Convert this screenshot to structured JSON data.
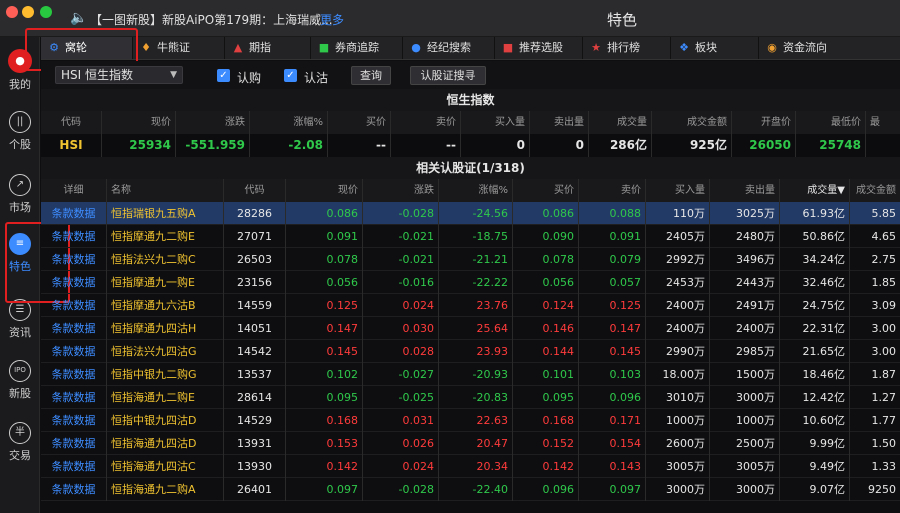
{
  "titlebar": {
    "news_text": "【一图新股】新股AiPO第179期：上海瑞威...",
    "more_label": "更多",
    "window_title": "特色"
  },
  "sidebar": {
    "items": [
      {
        "label": "我的",
        "icon": "avatar-icon"
      },
      {
        "label": "个股",
        "icon": "stock-icon"
      },
      {
        "label": "市场",
        "icon": "market-icon"
      },
      {
        "label": "特色",
        "icon": "feature-icon"
      },
      {
        "label": "资讯",
        "icon": "news-icon"
      },
      {
        "label": "新股",
        "icon": "ipo-icon"
      },
      {
        "label": "交易",
        "icon": "trade-icon"
      }
    ],
    "ipo_badge": "IPO",
    "trade_badge": "半"
  },
  "toolbar": {
    "tabs": [
      {
        "label": "窝轮",
        "icon": "warrant-icon",
        "color": "#3d8cff"
      },
      {
        "label": "牛熊证",
        "icon": "bull-icon",
        "color": "#f0a030"
      },
      {
        "label": "期指",
        "icon": "futures-chart-icon",
        "color": "#e04040"
      },
      {
        "label": "券商追踪",
        "icon": "broker-icon",
        "color": "#2fc84b"
      },
      {
        "label": "经纪搜索",
        "icon": "search-icon",
        "color": "#3d8cff"
      },
      {
        "label": "推荐选股",
        "icon": "recommend-icon",
        "color": "#e04040"
      },
      {
        "label": "排行榜",
        "icon": "ranking-icon",
        "color": "#e04040"
      },
      {
        "label": "板块",
        "icon": "sector-icon",
        "color": "#3d8cff"
      },
      {
        "label": "资金流向",
        "icon": "money-flow-icon",
        "color": "#f0a030"
      }
    ]
  },
  "filters": {
    "index_select": "HSI  恒生指数",
    "call_label": "认购",
    "put_label": "认沽",
    "query_button": "查询",
    "search_button": "认股证搜寻"
  },
  "index_panel": {
    "title": "恒生指数",
    "headers": [
      "代码",
      "现价",
      "涨跌",
      "涨幅%",
      "买价",
      "卖价",
      "买入量",
      "卖出量",
      "成交量",
      "成交金额",
      "开盘价",
      "最低价",
      "最"
    ],
    "row": [
      "HSI",
      "25934",
      "-551.959",
      "-2.08",
      "--",
      "--",
      "0",
      "0",
      "286亿",
      "925亿",
      "26050",
      "25748",
      ""
    ]
  },
  "warrants": {
    "title": "相关认股证(1/318)",
    "headers": [
      "详细",
      "名称",
      "代码",
      "现价",
      "涨跌",
      "涨幅%",
      "买价",
      "卖价",
      "买入量",
      "卖出量",
      "成交量▼",
      "成交金额"
    ],
    "rows": [
      {
        "detail": "条款数据",
        "name": "恒指瑞银九五购A",
        "code": "28286",
        "price": "0.086",
        "chg": "-0.028",
        "pct": "-24.56",
        "bid": "0.086",
        "ask": "0.088",
        "bidv": "110万",
        "askv": "3025万",
        "vol": "61.93亿",
        "amt": "5.85",
        "dir": "down",
        "selected": true
      },
      {
        "detail": "条款数据",
        "name": "恒指摩通九二购E",
        "code": "27071",
        "price": "0.091",
        "chg": "-0.021",
        "pct": "-18.75",
        "bid": "0.090",
        "ask": "0.091",
        "bidv": "2405万",
        "askv": "2480万",
        "vol": "50.86亿",
        "amt": "4.65",
        "dir": "down"
      },
      {
        "detail": "条款数据",
        "name": "恒指法兴九二购C",
        "code": "26503",
        "price": "0.078",
        "chg": "-0.021",
        "pct": "-21.21",
        "bid": "0.078",
        "ask": "0.079",
        "bidv": "2992万",
        "askv": "3496万",
        "vol": "34.24亿",
        "amt": "2.75",
        "dir": "down"
      },
      {
        "detail": "条款数据",
        "name": "恒指摩通九一购E",
        "code": "23156",
        "price": "0.056",
        "chg": "-0.016",
        "pct": "-22.22",
        "bid": "0.056",
        "ask": "0.057",
        "bidv": "2453万",
        "askv": "2443万",
        "vol": "32.46亿",
        "amt": "1.85",
        "dir": "down"
      },
      {
        "detail": "条款数据",
        "name": "恒指摩通九六沽B",
        "code": "14559",
        "price": "0.125",
        "chg": "0.024",
        "pct": "23.76",
        "bid": "0.124",
        "ask": "0.125",
        "bidv": "2400万",
        "askv": "2491万",
        "vol": "24.75亿",
        "amt": "3.09",
        "dir": "up"
      },
      {
        "detail": "条款数据",
        "name": "恒指摩通九四沽H",
        "code": "14051",
        "price": "0.147",
        "chg": "0.030",
        "pct": "25.64",
        "bid": "0.146",
        "ask": "0.147",
        "bidv": "2400万",
        "askv": "2400万",
        "vol": "22.31亿",
        "amt": "3.00",
        "dir": "up"
      },
      {
        "detail": "条款数据",
        "name": "恒指法兴九四沽G",
        "code": "14542",
        "price": "0.145",
        "chg": "0.028",
        "pct": "23.93",
        "bid": "0.144",
        "ask": "0.145",
        "bidv": "2990万",
        "askv": "2985万",
        "vol": "21.65亿",
        "amt": "3.00",
        "dir": "up"
      },
      {
        "detail": "条款数据",
        "name": "恒指中银九二购G",
        "code": "13537",
        "price": "0.102",
        "chg": "-0.027",
        "pct": "-20.93",
        "bid": "0.101",
        "ask": "0.103",
        "bidv": "18.00万",
        "askv": "1500万",
        "vol": "18.46亿",
        "amt": "1.87",
        "dir": "down"
      },
      {
        "detail": "条款数据",
        "name": "恒指海通九二购E",
        "code": "28614",
        "price": "0.095",
        "chg": "-0.025",
        "pct": "-20.83",
        "bid": "0.095",
        "ask": "0.096",
        "bidv": "3010万",
        "askv": "3000万",
        "vol": "12.42亿",
        "amt": "1.27",
        "dir": "down"
      },
      {
        "detail": "条款数据",
        "name": "恒指中银九四沽D",
        "code": "14529",
        "price": "0.168",
        "chg": "0.031",
        "pct": "22.63",
        "bid": "0.168",
        "ask": "0.171",
        "bidv": "1000万",
        "askv": "1000万",
        "vol": "10.60亿",
        "amt": "1.77",
        "dir": "up"
      },
      {
        "detail": "条款数据",
        "name": "恒指海通九四沽D",
        "code": "13931",
        "price": "0.153",
        "chg": "0.026",
        "pct": "20.47",
        "bid": "0.152",
        "ask": "0.154",
        "bidv": "2600万",
        "askv": "2500万",
        "vol": "9.99亿",
        "amt": "1.50",
        "dir": "up"
      },
      {
        "detail": "条款数据",
        "name": "恒指海通九四沽C",
        "code": "13930",
        "price": "0.142",
        "chg": "0.024",
        "pct": "20.34",
        "bid": "0.142",
        "ask": "0.143",
        "bidv": "3005万",
        "askv": "3005万",
        "vol": "9.49亿",
        "amt": "1.33",
        "dir": "up"
      },
      {
        "detail": "条款数据",
        "name": "恒指海通九二购A",
        "code": "26401",
        "price": "0.097",
        "chg": "-0.028",
        "pct": "-22.40",
        "bid": "0.096",
        "ask": "0.097",
        "bidv": "3000万",
        "askv": "3000万",
        "vol": "9.07亿",
        "amt": "9250",
        "dir": "down"
      }
    ]
  },
  "colors": {
    "up": "#ff3b3b",
    "down": "#2fc84b",
    "accent": "#3d8cff",
    "name": "#f0c330",
    "highlight": "#e02020"
  }
}
